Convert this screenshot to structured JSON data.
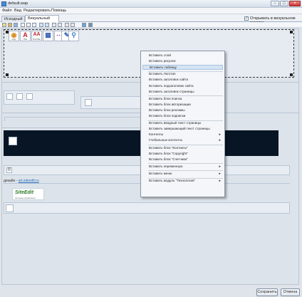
{
  "window": {
    "title": "default.wap",
    "caption_buttons": [
      "−",
      "□",
      "×"
    ]
  },
  "menubar": {
    "items": [
      "Файл",
      "Вид",
      "Редактировать",
      "Помощь"
    ]
  },
  "tabs": [
    {
      "label": "Исходный код",
      "active": false
    },
    {
      "label": "Визуальный редактор",
      "active": true
    }
  ],
  "visual_mode": {
    "label": "Открывать в визуальном режиме",
    "checked": true,
    "check_glyph": "✓"
  },
  "palette": {
    "widgets": [
      {
        "glyph": "◉",
        "label": "logo",
        "color": "#d98a1a"
      },
      {
        "glyph": "A",
        "label": "Title",
        "color": "#c0202a"
      },
      {
        "glyph": "AA",
        "label": "SubTitle",
        "color": "#c0202a"
      },
      {
        "glyph": "▦",
        "label": "",
        "color": "#3a62b5"
      },
      {
        "glyph": "⋯",
        "label": "",
        "color": "#8b3fb0"
      },
      {
        "glyph": "✎",
        "label": "",
        "color": "#3a62b5"
      },
      {
        "glyph": "⚲",
        "label": "",
        "color": "#2d7ac7"
      }
    ]
  },
  "content": {
    "footer_text": "дизайн - ",
    "footer_link": "art.siteedit.ru",
    "brand_logo": "SiteEdit",
    "brand_tagline": "система управления"
  },
  "context_menu": {
    "items": [
      {
        "label": "Вставить слой",
        "submenu": false,
        "highlighted": false
      },
      {
        "label": "Вставить рисунок",
        "submenu": false,
        "highlighted": false
      },
      {
        "label": "Вставить таблицу",
        "submenu": false,
        "highlighted": true
      },
      {
        "sep": true
      },
      {
        "label": "Вставить Логотип",
        "submenu": false,
        "highlighted": false
      },
      {
        "label": "Вставить заголовок сайта",
        "submenu": false,
        "highlighted": false
      },
      {
        "label": "Вставить подзаголовок сайта",
        "submenu": false,
        "highlighted": false
      },
      {
        "label": "Вставить заголовок страницы",
        "submenu": false,
        "highlighted": false
      },
      {
        "sep": true
      },
      {
        "label": "Вставить блок поиска",
        "submenu": false,
        "highlighted": false
      },
      {
        "label": "Вставить блок авторизации",
        "submenu": false,
        "highlighted": false
      },
      {
        "label": "Вставить блок рекламы",
        "submenu": false,
        "highlighted": false
      },
      {
        "label": "Вставить блок подписки",
        "submenu": false,
        "highlighted": false
      },
      {
        "sep": true
      },
      {
        "label": "Вставить вводный текст страницы",
        "submenu": false,
        "highlighted": false
      },
      {
        "label": "Вставить завершающий текст страницы",
        "submenu": false,
        "highlighted": false
      },
      {
        "label": "Контенты",
        "submenu": true,
        "highlighted": false
      },
      {
        "label": "Глобальные контенты",
        "submenu": true,
        "highlighted": false
      },
      {
        "sep": true
      },
      {
        "label": "Вставить блок \"Контакты\"",
        "submenu": false,
        "highlighted": false
      },
      {
        "label": "Вставить блок \"Copyright\"",
        "submenu": false,
        "highlighted": false
      },
      {
        "label": "Вставить блок \"Счетчики\"",
        "submenu": false,
        "highlighted": false
      },
      {
        "sep": true
      },
      {
        "label": "Вставить переменную",
        "submenu": true,
        "highlighted": false
      },
      {
        "sep": true
      },
      {
        "label": "Вставить меню",
        "submenu": true,
        "highlighted": false
      },
      {
        "sep": true
      },
      {
        "label": "Вставить модуль \"Технология\"",
        "submenu": true,
        "highlighted": false
      }
    ],
    "arrow_glyph": "▸"
  },
  "buttons": {
    "save": "Сохранить",
    "cancel": "Отмена"
  },
  "colors": {
    "accent": "#2a6fc0",
    "dark_band": "#081525",
    "highlight": "#d5e3f3"
  }
}
